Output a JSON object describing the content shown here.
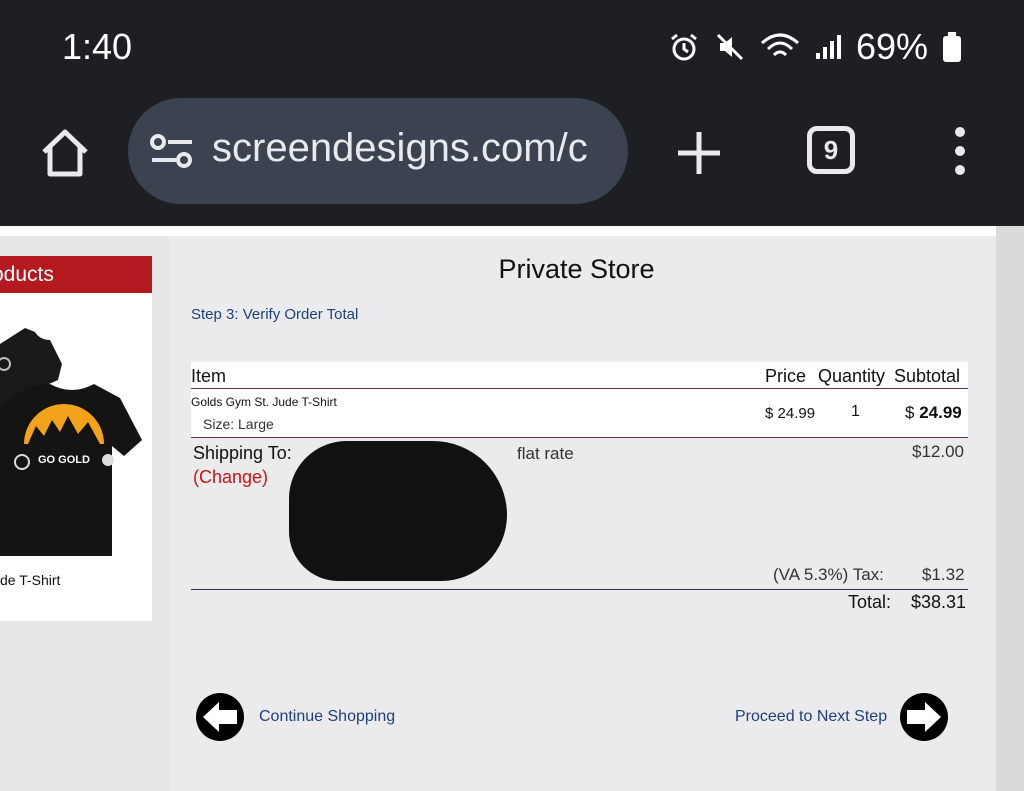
{
  "status_bar": {
    "time": "1:40",
    "battery_percent": "69%"
  },
  "browser": {
    "url": "screendesigns.com/c",
    "tab_count": "9"
  },
  "sidebar": {
    "header": "oducts",
    "product_name": "de T-Shirt"
  },
  "store": {
    "title": "Private Store",
    "step": "Step 3: Verify Order Total",
    "columns": {
      "item": "Item",
      "price": "Price",
      "quantity": "Quantity",
      "subtotal": "Subtotal"
    },
    "items": [
      {
        "name": "Golds Gym St. Jude T-Shirt",
        "size": "Size: Large",
        "price": "$ 24.99",
        "quantity": "1",
        "subtotal_symbol": "$",
        "subtotal": "24.99"
      }
    ],
    "shipping_label": "Shipping To:",
    "change_link": "(Change)",
    "shipping_method": "flat rate",
    "shipping_cost": "$12.00",
    "tax_label": "(VA 5.3%) Tax:",
    "tax_amount": "$1.32",
    "total_label": "Total:",
    "total_amount": "$38.31",
    "continue_label": "Continue Shopping",
    "next_label": "Proceed to Next Step"
  },
  "colors": {
    "sidebar_header": "#b3191f",
    "link": "#1f3f7a",
    "change": "#cc1111",
    "browser_bg": "#1d1f22"
  }
}
